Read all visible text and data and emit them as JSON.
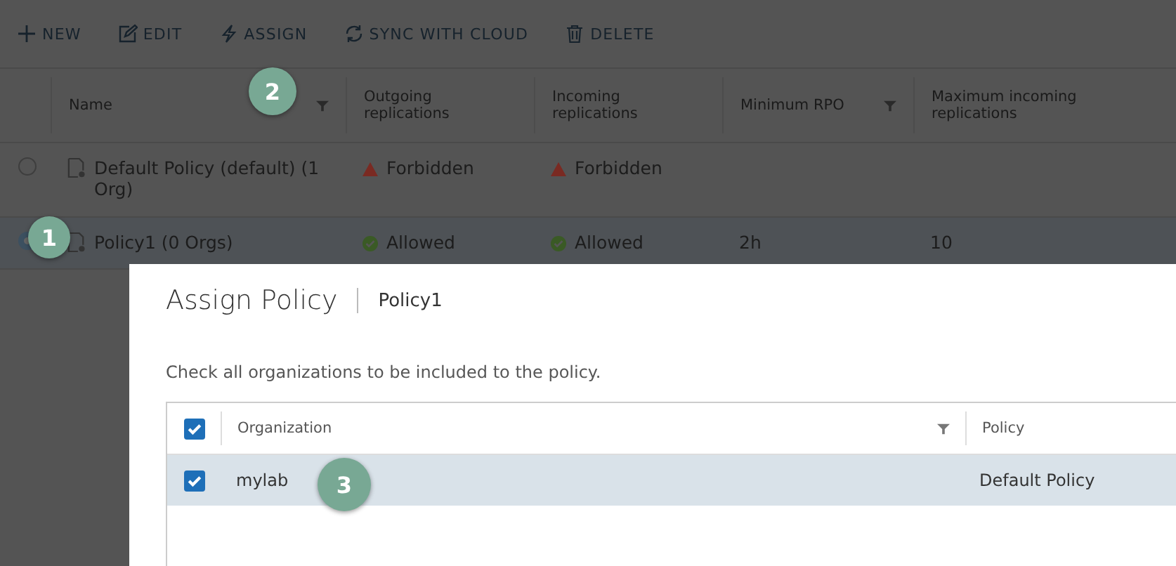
{
  "toolbar": [
    {
      "kind": "plus",
      "label": "NEW"
    },
    {
      "kind": "edit",
      "label": "EDIT"
    },
    {
      "kind": "bolt",
      "label": "ASSIGN"
    },
    {
      "kind": "sync",
      "label": "SYNC WITH CLOUD"
    },
    {
      "kind": "trash",
      "label": "DELETE"
    }
  ],
  "table": {
    "columns": [
      {
        "label": "Name",
        "filter": true
      },
      {
        "label": "Outgoing replications",
        "filter": false
      },
      {
        "label": "Incoming replications",
        "filter": false
      },
      {
        "label": "Minimum RPO",
        "filter": true
      },
      {
        "label": "Maximum incoming replications",
        "filter": false
      }
    ],
    "rows": [
      {
        "selected": false,
        "name": "Default Policy (default) (1 Org)",
        "outgoing": {
          "kind": "forbidden",
          "text": "Forbidden"
        },
        "incoming": {
          "kind": "forbidden",
          "text": "Forbidden"
        },
        "rpo": "",
        "max": ""
      },
      {
        "selected": true,
        "name": "Policy1 (0 Orgs)",
        "outgoing": {
          "kind": "allowed",
          "text": "Allowed"
        },
        "incoming": {
          "kind": "allowed",
          "text": "Allowed"
        },
        "rpo": "2h",
        "max": "10"
      }
    ]
  },
  "dialog": {
    "title": "Assign Policy",
    "subtitle": "Policy1",
    "description": "Check all organizations to be included to the policy.",
    "select_all_checked": true,
    "columns": [
      {
        "label": "Organization",
        "filter": true
      },
      {
        "label": "Policy",
        "filter": false
      }
    ],
    "rows": [
      {
        "checked": true,
        "organization": "mylab",
        "policy": "Default Policy"
      }
    ]
  },
  "callouts": [
    "1",
    "2",
    "3"
  ]
}
